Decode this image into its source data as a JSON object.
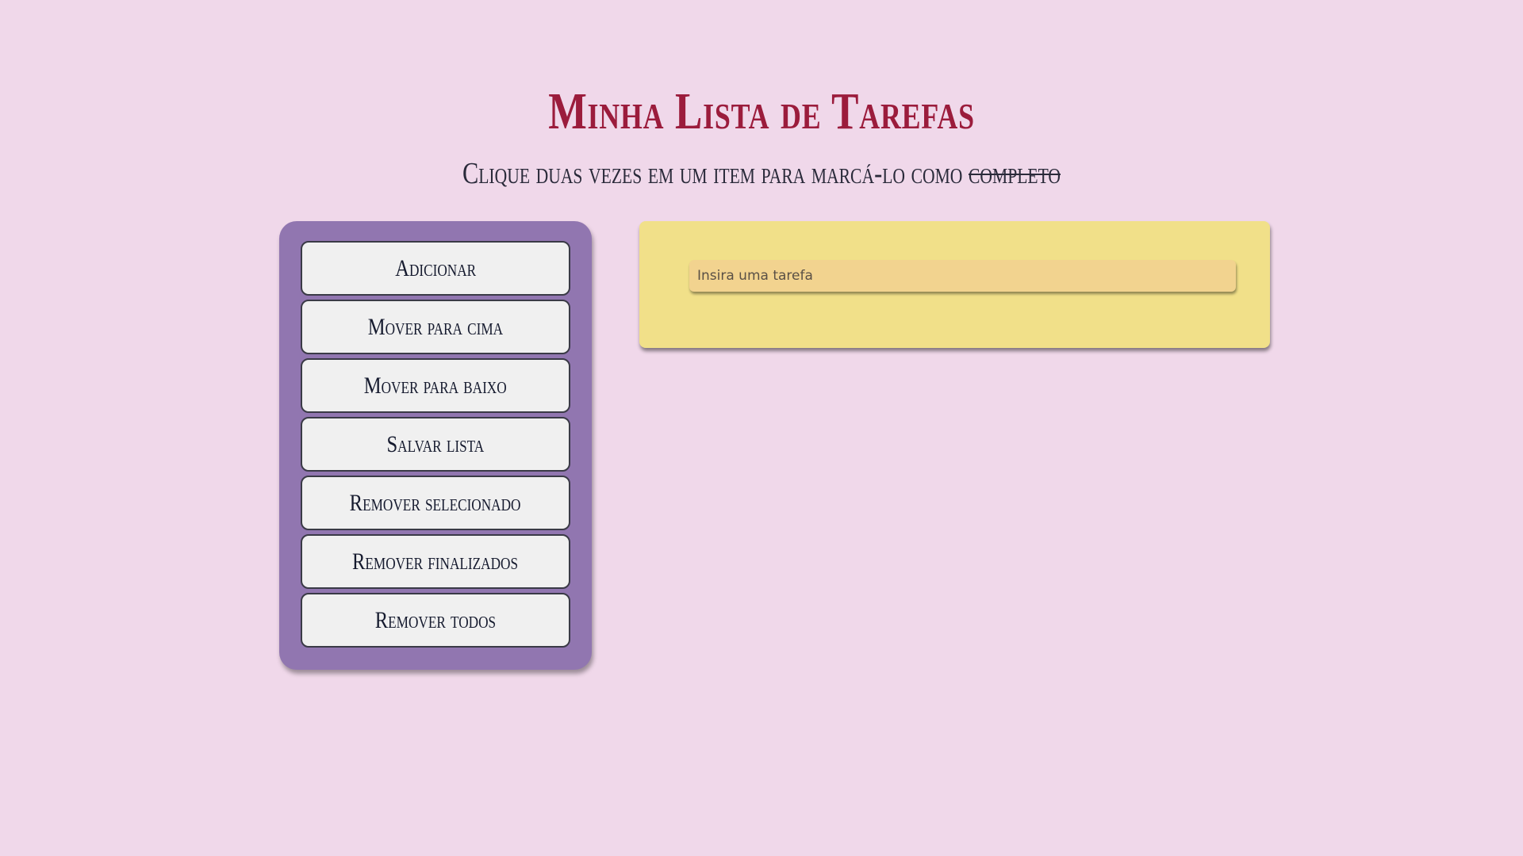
{
  "header": {
    "title": "Minha Lista de Tarefas",
    "instruction_prefix": "Clique duas vezes em um item para marcá-lo como ",
    "instruction_struck_word": "completo"
  },
  "controls": {
    "buttons": [
      {
        "label": "Adicionar"
      },
      {
        "label": "Mover para cima"
      },
      {
        "label": "Mover para baixo"
      },
      {
        "label": "Salvar lista"
      },
      {
        "label": "Remover selecionado"
      },
      {
        "label": "Remover finalizados"
      },
      {
        "label": "Remover todos"
      }
    ]
  },
  "task_entry": {
    "placeholder": "Insira uma tarefa",
    "value": ""
  },
  "tasks": [],
  "colors": {
    "background": "#f0d8ea",
    "title": "#9b1c3c",
    "controls_panel": "#9176b0",
    "button": "#f0f0f0",
    "note_panel": "#f1e089",
    "input": "#f2d38f"
  }
}
